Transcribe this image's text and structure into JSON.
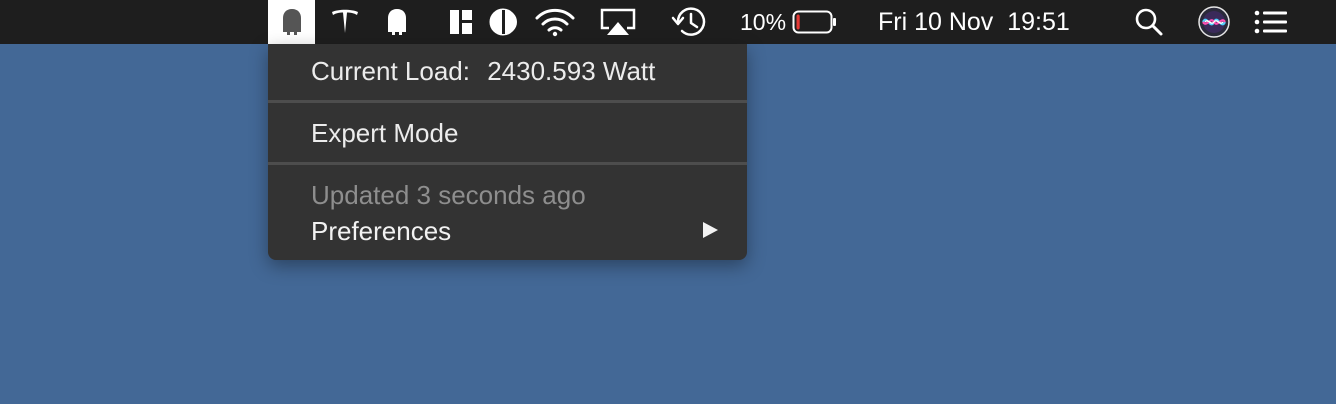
{
  "menubar": {
    "icons": [
      {
        "name": "power-monitor-icon",
        "active": true
      },
      {
        "name": "tesla-logo-icon"
      },
      {
        "name": "house-icon"
      },
      {
        "name": "grid-layout-icon"
      },
      {
        "name": "contrast-icon"
      },
      {
        "name": "wifi-icon"
      },
      {
        "name": "airplay-icon"
      },
      {
        "name": "time-machine-icon"
      },
      {
        "name": "battery-icon"
      },
      {
        "name": "spotlight-search-icon"
      },
      {
        "name": "siri-icon"
      },
      {
        "name": "notification-center-icon"
      }
    ],
    "battery_percent": "10%",
    "battery_level": 0.1,
    "datetime": "Fri 10 Nov  19:51"
  },
  "menu": {
    "current_load_label": "Current Load:",
    "current_load_value": "2430.593 Watt",
    "expert_mode": "Expert Mode",
    "updated": "Updated 3 seconds ago",
    "preferences": "Preferences"
  },
  "colors": {
    "desktop": "#436896",
    "menubar": "#1e1e1e",
    "menu_bg": "#333333",
    "battery_low": "#e53935"
  }
}
